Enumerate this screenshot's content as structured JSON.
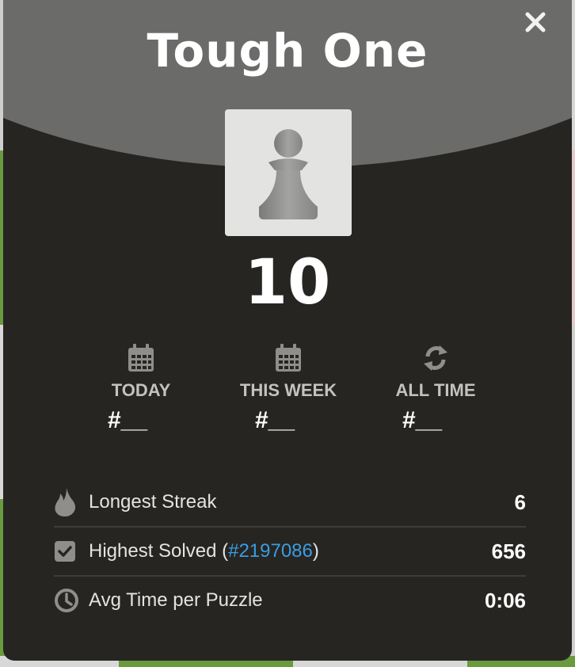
{
  "modal": {
    "title": "Tough One",
    "score": "10",
    "avatar_icon": "pawn-icon",
    "close_icon": "close-icon"
  },
  "ranks": [
    {
      "icon": "calendar-icon",
      "label": "TODAY",
      "value": "#__"
    },
    {
      "icon": "calendar-icon",
      "label": "THIS WEEK",
      "value": "#__"
    },
    {
      "icon": "refresh-icon",
      "label": "ALL TIME",
      "value": "#__"
    }
  ],
  "stats": {
    "streak": {
      "icon": "flame-icon",
      "label": "Longest Streak",
      "value": "6"
    },
    "highest": {
      "icon": "checkbox-icon",
      "label_prefix": "Highest Solved (",
      "link": "#2197086",
      "label_suffix": ")",
      "value": "656"
    },
    "avg_time": {
      "icon": "clock-icon",
      "label": "Avg Time per Puzzle",
      "value": "0:06"
    }
  },
  "colors": {
    "modal_bg": "#262522",
    "header_arc": "#6b6b6a",
    "link": "#3b9ce0"
  }
}
